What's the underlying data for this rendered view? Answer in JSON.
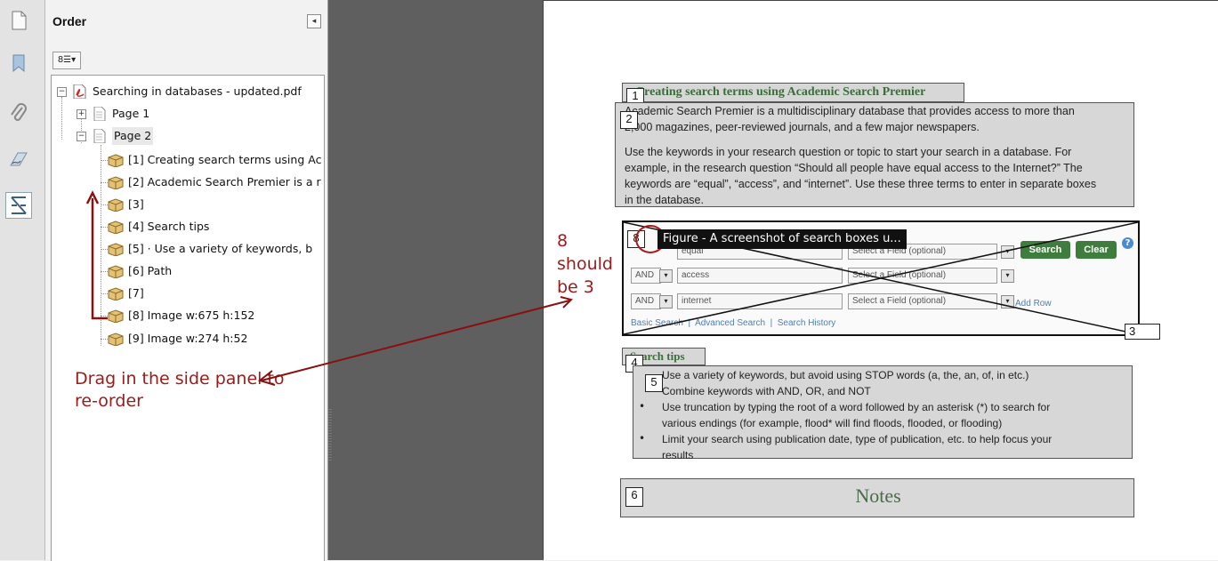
{
  "rail": {
    "icons": [
      "page-thumbnails-icon",
      "bookmarks-icon",
      "attachments-icon",
      "signatures-icon",
      "order-icon"
    ]
  },
  "panel": {
    "title": "Order",
    "collapse_glyph": "◂",
    "options_glyph": "8☰▾",
    "tree": {
      "document": "Searching in databases - updated.pdf",
      "pages": [
        "Page 1",
        "Page 2"
      ],
      "items": [
        "[1] Creating search terms using Ac",
        "[2] Academic Search Premier is a r",
        "[3]",
        "[4] Search tips",
        "[5]  · Use a variety of keywords, b",
        "[6] Path",
        "[7]",
        "[8] Image  w:675 h:152",
        "[9] Image  w:274 h:52"
      ]
    },
    "annotation": "Drag in the side panel to re-order"
  },
  "annotation_should": [
    "8",
    "should",
    "be 3"
  ],
  "page": {
    "tags": [
      "1",
      "2",
      "8",
      "3",
      "4",
      "5",
      "6"
    ],
    "heading1": "Creating search terms using Academic Search Premier",
    "para1_lines": [
      "Academic Search Premier is a multidisciplinary database that provides access to more than",
      "2,000 magazines, peer-reviewed journals, and a few major newspapers."
    ],
    "para2_lines": [
      "Use the keywords in your research question or topic to start your search in a database. For",
      "example, in the research question “Should all people have equal access to the Internet?” The",
      "keywords are “equal”, “access”, and “internet”. Use these three terms to enter in separate boxes",
      "in the database."
    ],
    "figure_tooltip": "Figure - A screenshot of search boxes u...",
    "searchbox": {
      "row1_term": "equal",
      "row1_select": "Select a Field (optional)",
      "row2_op": "AND",
      "row2_term": "access",
      "row2_select": "Select a Field (optional)",
      "row3_op": "AND",
      "row3_term": "internet",
      "row3_select": "Select a Field (optional)",
      "search_btn": "Search",
      "clear_btn": "Clear",
      "add_row": "Add Row",
      "help_glyph": "?",
      "links": "Basic Search  |  Advanced Search  |  Search History"
    },
    "heading2": "Search tips",
    "tips": [
      "Use a variety of keywords, but avoid using STOP words (a, the, an, of, in etc.)",
      "Combine keywords with AND, OR, and NOT",
      "Use truncation by typing the root of a word followed by an asterisk (*) to search for",
      "various endings (for example, flood* will find floods, flooded, or flooding)",
      "Limit your search using publication date, type of publication, etc. to help focus your",
      "results"
    ],
    "notes": "Notes"
  },
  "colors": {
    "annotation_red": "#9b1b1b",
    "heading_green": "#3a6e39",
    "button_green": "#3f7d3f"
  }
}
